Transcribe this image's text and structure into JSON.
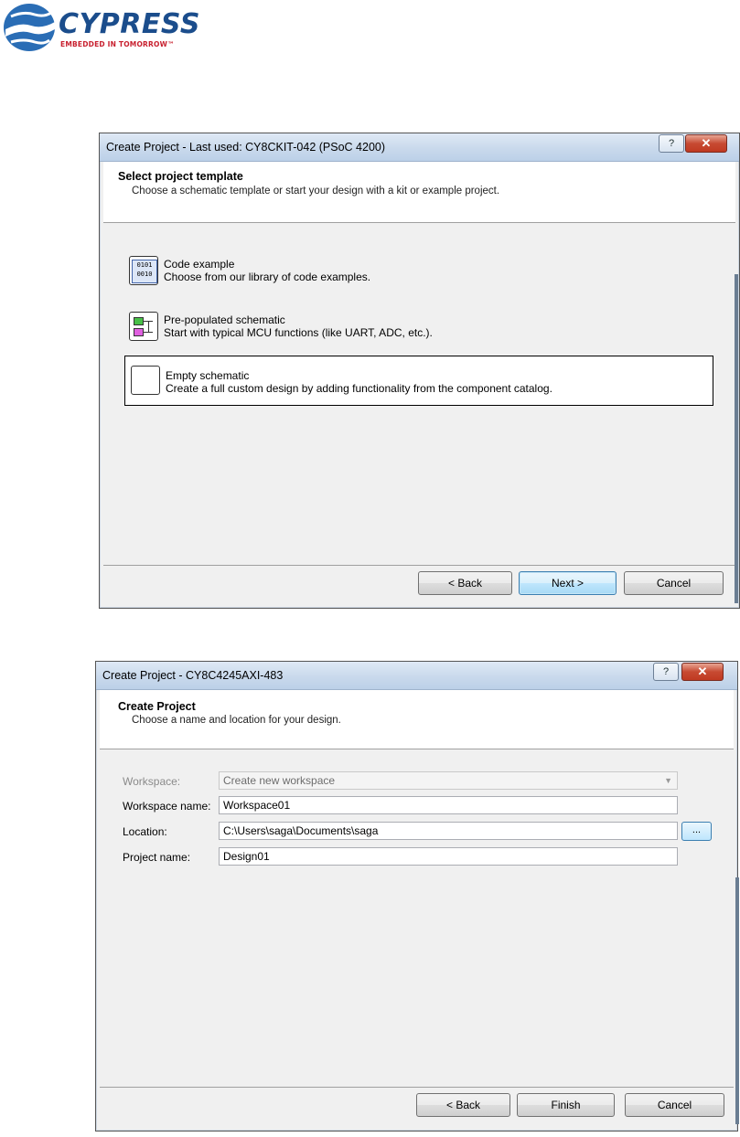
{
  "logo": {
    "name": "CYPRESS",
    "tagline": "EMBEDDED IN TOMORROW™"
  },
  "dialog1": {
    "title": "Create Project - Last used: CY8CKIT-042 (PSoC 4200)",
    "help_label": "?",
    "close_label": "✕",
    "heading": "Select project template",
    "subheading": "Choose a schematic template or start your design with a kit or example project.",
    "options": [
      {
        "title": "Code example",
        "description": "Choose from our library of code examples.",
        "icon": "code-example-icon"
      },
      {
        "title": "Pre-populated schematic",
        "description": "Start with typical MCU functions (like UART, ADC, etc.).",
        "icon": "schematic-icon"
      },
      {
        "title": "Empty schematic",
        "description": "Create a full custom design by adding functionality from the component catalog.",
        "icon": "empty-schematic-icon",
        "selected": true
      }
    ],
    "buttons": {
      "back": "Back",
      "next": "Next >",
      "cancel": "Cancel"
    }
  },
  "dialog2": {
    "title": "Create Project - CY8C4245AXI-483",
    "help_label": "?",
    "close_label": "✕",
    "heading": "Create Project",
    "subheading": "Choose a name and location for your design.",
    "form": {
      "workspace_label": "Workspace:",
      "workspace_value": "Create new workspace",
      "workspace_name_label": "Workspace name:",
      "workspace_name_value": "Workspace01",
      "location_label": "Location:",
      "location_value": "C:\\Users\\saga\\Documents\\saga",
      "browse_label": "...",
      "project_name_label": "Project name:",
      "project_name_value": "Design01"
    },
    "buttons": {
      "back": "Back",
      "finish": "Finish",
      "cancel": "Cancel"
    }
  },
  "colors": {
    "brand_blue": "#1b4d8c",
    "brand_red": "#c8202f",
    "titlebar": "#c9d9ec",
    "close": "#c74a32"
  }
}
